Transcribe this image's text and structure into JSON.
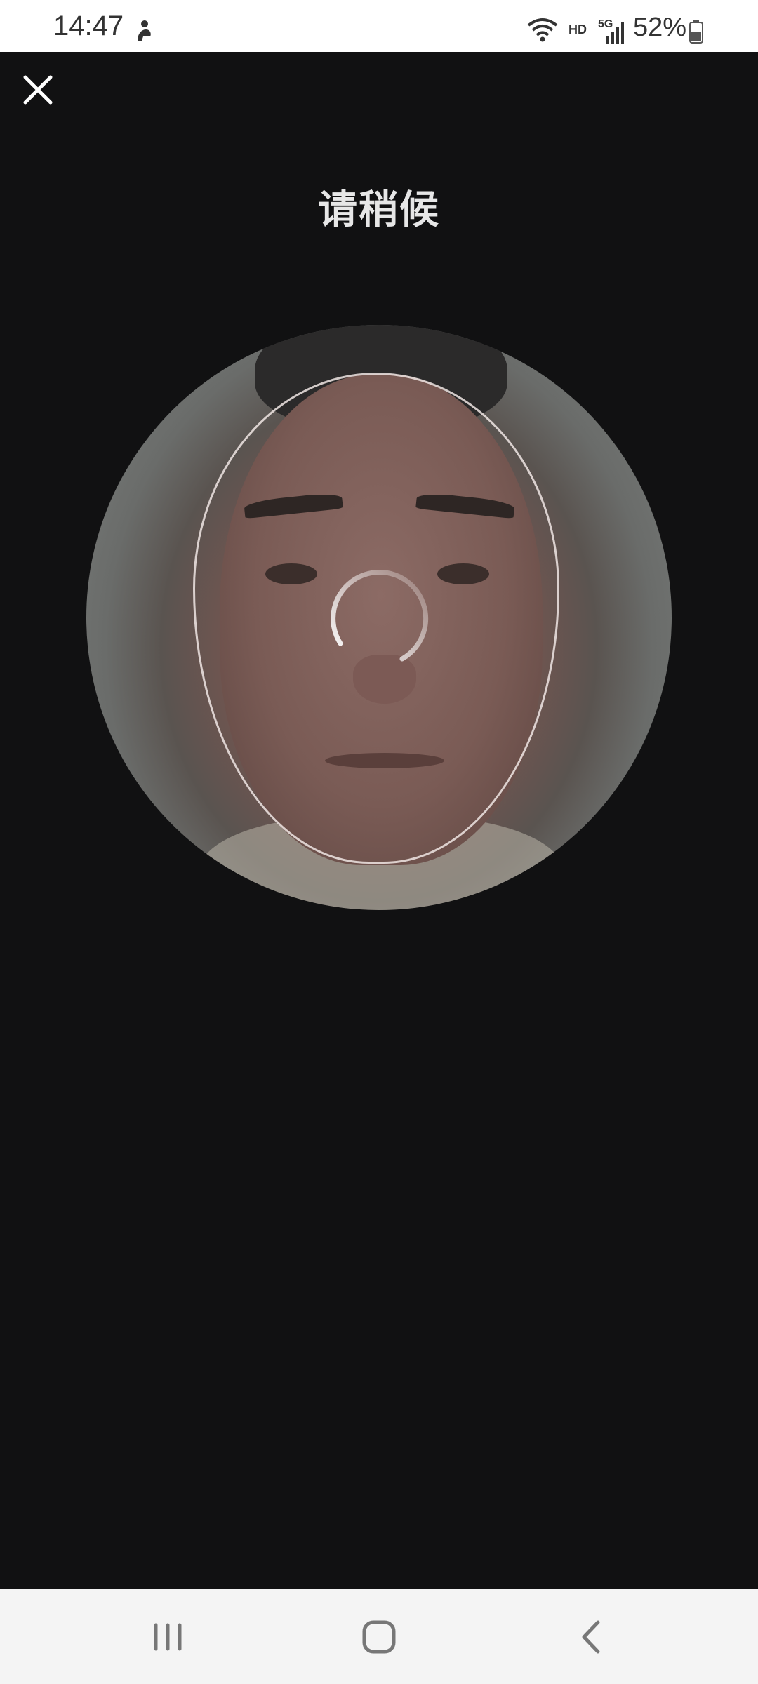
{
  "status_bar": {
    "time": "14:47",
    "network_hd": "HD",
    "network_type": "5G",
    "battery_percent": "52%"
  },
  "header": {
    "title": "请稍候"
  },
  "camera": {
    "state": "loading"
  },
  "colors": {
    "background": "#111112",
    "status_bar_bg": "#ffffff",
    "nav_bar_bg": "#f4f4f4",
    "title_text": "#e7e7e7"
  },
  "icons": {
    "close": "close-icon",
    "spinner": "loading-spinner-icon",
    "recent_apps": "recent-apps-icon",
    "home": "home-icon",
    "back": "back-icon"
  }
}
